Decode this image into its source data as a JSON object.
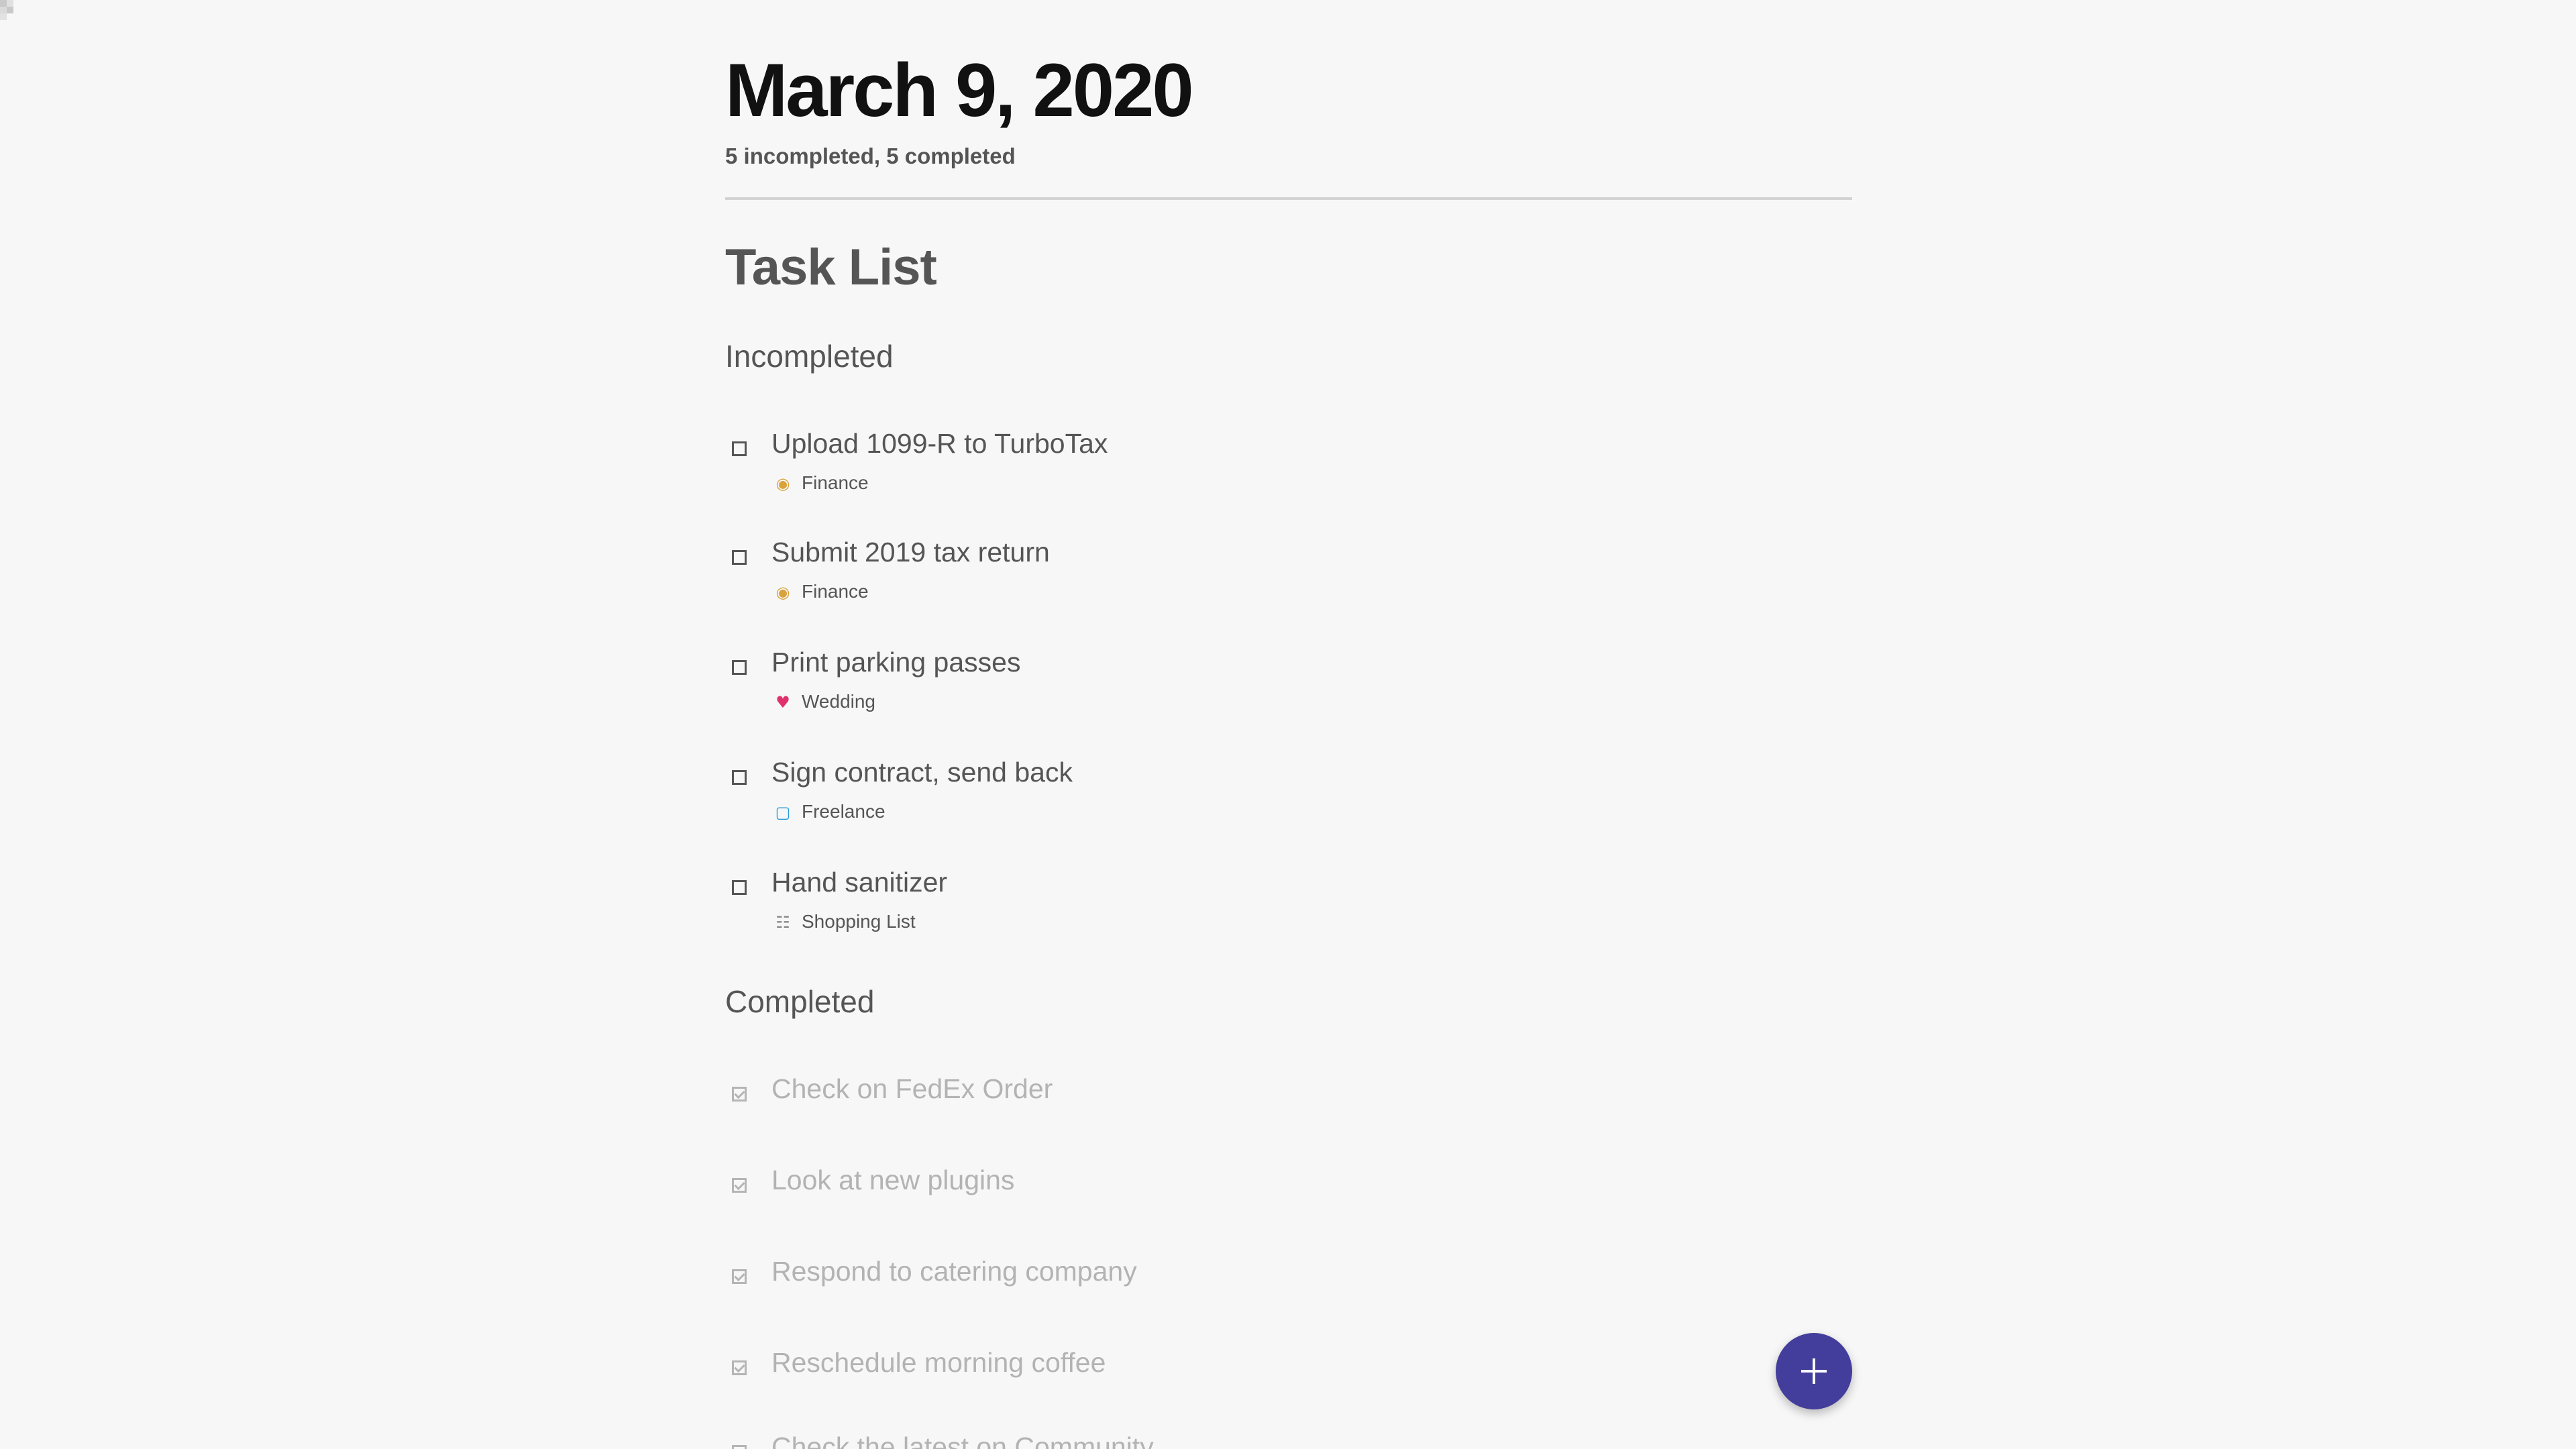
{
  "header": {
    "date_title": "March 9, 2020",
    "summary": "5 incompleted, 5 completed"
  },
  "task_list": {
    "title": "Task List",
    "incompleted_heading": "Incompleted",
    "completed_heading": "Completed",
    "incompleted": [
      {
        "title": "Upload 1099-R to TurboTax",
        "tag": "Finance",
        "tag_icon": "money-bag-icon"
      },
      {
        "title": "Submit 2019 tax return",
        "tag": "Finance",
        "tag_icon": "money-bag-icon"
      },
      {
        "title": "Print parking passes",
        "tag": "Wedding",
        "tag_icon": "two-hearts-icon"
      },
      {
        "title": "Sign contract, send back",
        "tag": "Freelance",
        "tag_icon": "computer-icon"
      },
      {
        "title": "Hand sanitizer",
        "tag": "Shopping List",
        "tag_icon": "shopping-cart-icon"
      }
    ],
    "completed": [
      {
        "title": "Check on FedEx Order"
      },
      {
        "title": "Look at new plugins"
      },
      {
        "title": "Respond to catering company"
      },
      {
        "title": "Reschedule morning coffee"
      },
      {
        "title": "Check the latest on Community"
      }
    ]
  },
  "fab": {
    "icon": "plus-icon",
    "color": "#433e9b"
  },
  "colors": {
    "background": "#f7f7f7",
    "text_dark": "#111111",
    "text_muted": "#555555",
    "text_completed": "#b3b3b3",
    "accent": "#433e9b"
  }
}
